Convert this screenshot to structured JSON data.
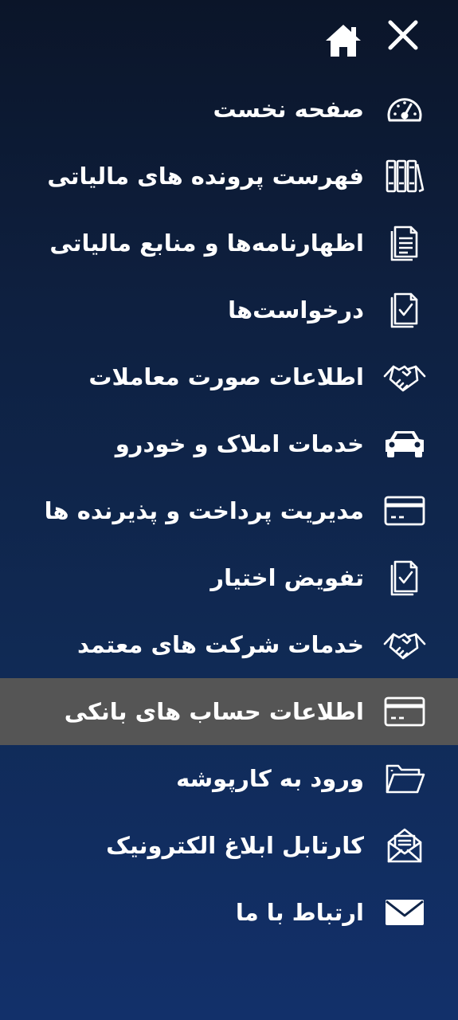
{
  "topbar": {
    "close_icon": "close-icon",
    "home_icon": "home-icon"
  },
  "colors": {
    "background_top": "#0b1529",
    "background_bottom": "#12306a",
    "active_item_bg": "#555555",
    "text": "#ffffff"
  },
  "menu": {
    "active_index": 9,
    "items": [
      {
        "label": "صفحه نخست",
        "icon": "dashboard-gauge-icon"
      },
      {
        "label": "فهرست پرونده های مالیاتی",
        "icon": "binders-icon"
      },
      {
        "label": "اظهارنامه‌ها و منابع مالیاتی",
        "icon": "document-icon"
      },
      {
        "label": "درخواست‌ها",
        "icon": "document-check-icon"
      },
      {
        "label": "اطلاعات صورت معاملات",
        "icon": "handshake-icon"
      },
      {
        "label": "خدمات املاک و خودرو",
        "icon": "car-icon"
      },
      {
        "label": "مدیریت پرداخت و پذیرنده ها",
        "icon": "credit-card-icon"
      },
      {
        "label": "تفویض اختیار",
        "icon": "document-check-icon"
      },
      {
        "label": "خدمات شرکت های معتمد",
        "icon": "handshake-icon"
      },
      {
        "label": "اطلاعات حساب های بانکی",
        "icon": "credit-card-icon"
      },
      {
        "label": "ورود به کارپوشه",
        "icon": "folder-icon"
      },
      {
        "label": "کارتابل ابلاغ الکترونیک",
        "icon": "envelope-document-icon"
      },
      {
        "label": "ارتباط با ما",
        "icon": "envelope-icon"
      }
    ]
  }
}
